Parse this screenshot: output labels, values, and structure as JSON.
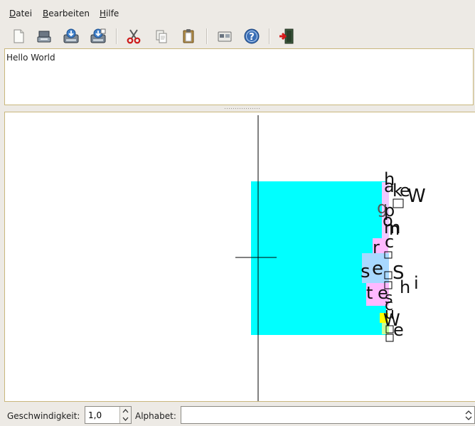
{
  "menubar": {
    "items": [
      {
        "mnemonic": "D",
        "rest": "atei"
      },
      {
        "mnemonic": "B",
        "rest": "earbeiten"
      },
      {
        "mnemonic": "H",
        "rest": "ilfe"
      }
    ]
  },
  "toolbar": {
    "icons": [
      "new-icon",
      "open-icon",
      "save-icon",
      "save-as-icon",
      "cut-icon",
      "copy-icon",
      "paste-icon",
      "properties-icon",
      "help-icon",
      "quit-icon"
    ]
  },
  "editor": {
    "text": "Hello World"
  },
  "canvas": {
    "letters": [
      "h",
      "a",
      "k",
      "e",
      "W",
      "g",
      "p",
      "o",
      "m",
      "n",
      "r",
      "c",
      "s",
      "e",
      "S",
      "h",
      "i",
      "t",
      "e",
      "s",
      "c",
      "u",
      "W",
      "e"
    ]
  },
  "status": {
    "speed_label": "Geschwindigkeit:",
    "speed_value": "1,0",
    "alphabet_label": "Alphabet:",
    "alphabet_value": ""
  }
}
